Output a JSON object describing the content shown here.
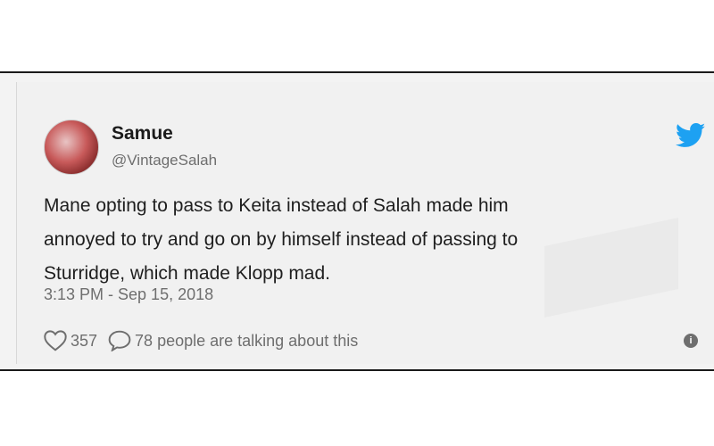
{
  "tweet": {
    "author_name": "Samue",
    "handle": "@VintageSalah",
    "lines": [
      "Mane opting to pass to Keita instead of Salah made him",
      "annoyed to try and go on by himself instead of passing to",
      "Sturridge, which made Klopp mad."
    ],
    "timestamp": "3:13 PM - Sep 15, 2018",
    "likes": "357",
    "conversation": "78 people are talking about this",
    "info_glyph": "i"
  },
  "icons": {
    "avatar": "avatar-image",
    "brand": "twitter-bird-icon",
    "like": "heart-icon",
    "reply": "speech-bubble-icon",
    "info": "info-icon"
  },
  "colors": {
    "brand_blue": "#1da1f2",
    "text": "#1e1e1e",
    "muted": "#6e6e6e",
    "card_bg": "#f1f1f1"
  }
}
